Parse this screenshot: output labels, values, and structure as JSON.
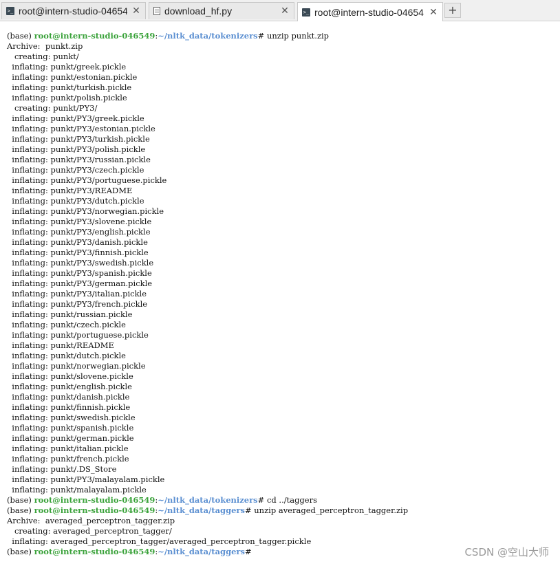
{
  "tabs": [
    {
      "title": "root@intern-studio-04654",
      "icon": "terminal-icon",
      "active": false
    },
    {
      "title": "download_hf.py",
      "icon": "document-icon",
      "active": false
    },
    {
      "title": "root@intern-studio-04654",
      "icon": "terminal-icon",
      "active": true
    }
  ],
  "new_tab_label": "+",
  "close_label": "✕",
  "terminal": {
    "lines": [
      {
        "kind": "prompt",
        "env": "(base) ",
        "user": "root@intern-studio-046549",
        "sep": ":",
        "path": "~/nltk_data/tokenizers",
        "suffix": "# ",
        "command": "unzip punkt.zip"
      },
      {
        "kind": "out",
        "text": "Archive:  punkt.zip"
      },
      {
        "kind": "out",
        "text": "   creating: punkt/"
      },
      {
        "kind": "out",
        "text": "  inflating: punkt/greek.pickle"
      },
      {
        "kind": "out",
        "text": "  inflating: punkt/estonian.pickle"
      },
      {
        "kind": "out",
        "text": "  inflating: punkt/turkish.pickle"
      },
      {
        "kind": "out",
        "text": "  inflating: punkt/polish.pickle"
      },
      {
        "kind": "out",
        "text": "   creating: punkt/PY3/"
      },
      {
        "kind": "out",
        "text": "  inflating: punkt/PY3/greek.pickle"
      },
      {
        "kind": "out",
        "text": "  inflating: punkt/PY3/estonian.pickle"
      },
      {
        "kind": "out",
        "text": "  inflating: punkt/PY3/turkish.pickle"
      },
      {
        "kind": "out",
        "text": "  inflating: punkt/PY3/polish.pickle"
      },
      {
        "kind": "out",
        "text": "  inflating: punkt/PY3/russian.pickle"
      },
      {
        "kind": "out",
        "text": "  inflating: punkt/PY3/czech.pickle"
      },
      {
        "kind": "out",
        "text": "  inflating: punkt/PY3/portuguese.pickle"
      },
      {
        "kind": "out",
        "text": "  inflating: punkt/PY3/README"
      },
      {
        "kind": "out",
        "text": "  inflating: punkt/PY3/dutch.pickle"
      },
      {
        "kind": "out",
        "text": "  inflating: punkt/PY3/norwegian.pickle"
      },
      {
        "kind": "out",
        "text": "  inflating: punkt/PY3/slovene.pickle"
      },
      {
        "kind": "out",
        "text": "  inflating: punkt/PY3/english.pickle"
      },
      {
        "kind": "out",
        "text": "  inflating: punkt/PY3/danish.pickle"
      },
      {
        "kind": "out",
        "text": "  inflating: punkt/PY3/finnish.pickle"
      },
      {
        "kind": "out",
        "text": "  inflating: punkt/PY3/swedish.pickle"
      },
      {
        "kind": "out",
        "text": "  inflating: punkt/PY3/spanish.pickle"
      },
      {
        "kind": "out",
        "text": "  inflating: punkt/PY3/german.pickle"
      },
      {
        "kind": "out",
        "text": "  inflating: punkt/PY3/italian.pickle"
      },
      {
        "kind": "out",
        "text": "  inflating: punkt/PY3/french.pickle"
      },
      {
        "kind": "out",
        "text": "  inflating: punkt/russian.pickle"
      },
      {
        "kind": "out",
        "text": "  inflating: punkt/czech.pickle"
      },
      {
        "kind": "out",
        "text": "  inflating: punkt/portuguese.pickle"
      },
      {
        "kind": "out",
        "text": "  inflating: punkt/README"
      },
      {
        "kind": "out",
        "text": "  inflating: punkt/dutch.pickle"
      },
      {
        "kind": "out",
        "text": "  inflating: punkt/norwegian.pickle"
      },
      {
        "kind": "out",
        "text": "  inflating: punkt/slovene.pickle"
      },
      {
        "kind": "out",
        "text": "  inflating: punkt/english.pickle"
      },
      {
        "kind": "out",
        "text": "  inflating: punkt/danish.pickle"
      },
      {
        "kind": "out",
        "text": "  inflating: punkt/finnish.pickle"
      },
      {
        "kind": "out",
        "text": "  inflating: punkt/swedish.pickle"
      },
      {
        "kind": "out",
        "text": "  inflating: punkt/spanish.pickle"
      },
      {
        "kind": "out",
        "text": "  inflating: punkt/german.pickle"
      },
      {
        "kind": "out",
        "text": "  inflating: punkt/italian.pickle"
      },
      {
        "kind": "out",
        "text": "  inflating: punkt/french.pickle"
      },
      {
        "kind": "out",
        "text": "  inflating: punkt/.DS_Store"
      },
      {
        "kind": "out",
        "text": "  inflating: punkt/PY3/malayalam.pickle"
      },
      {
        "kind": "out",
        "text": "  inflating: punkt/malayalam.pickle"
      },
      {
        "kind": "prompt",
        "env": "(base) ",
        "user": "root@intern-studio-046549",
        "sep": ":",
        "path": "~/nltk_data/tokenizers",
        "suffix": "# ",
        "command": "cd ../taggers"
      },
      {
        "kind": "prompt",
        "env": "(base) ",
        "user": "root@intern-studio-046549",
        "sep": ":",
        "path": "~/nltk_data/taggers",
        "suffix": "# ",
        "command": "unzip averaged_perceptron_tagger.zip"
      },
      {
        "kind": "out",
        "text": "Archive:  averaged_perceptron_tagger.zip"
      },
      {
        "kind": "out",
        "text": "   creating: averaged_perceptron_tagger/"
      },
      {
        "kind": "out",
        "text": "  inflating: averaged_perceptron_tagger/averaged_perceptron_tagger.pickle"
      },
      {
        "kind": "prompt",
        "env": "(base) ",
        "user": "root@intern-studio-046549",
        "sep": ":",
        "path": "~/nltk_data/taggers",
        "suffix": "#",
        "command": ""
      }
    ]
  },
  "watermark": "CSDN @空山大师",
  "colors": {
    "prompt_user": "#3aa23a",
    "prompt_path": "#5b8fd1"
  }
}
